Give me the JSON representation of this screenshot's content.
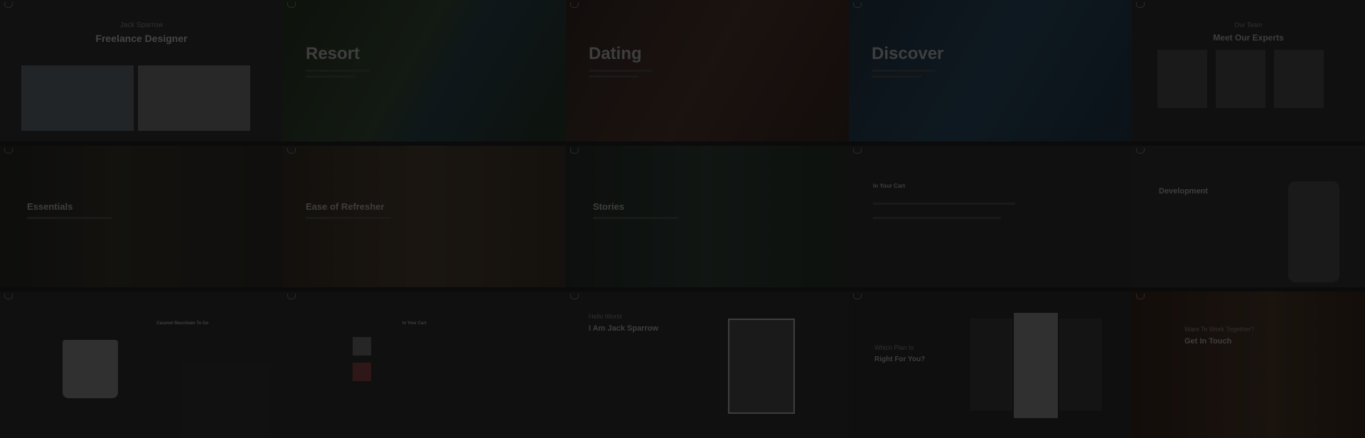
{
  "tiles": [
    {
      "id": "freelance",
      "kicker": "Jack Sparrow",
      "title": "Freelance Designer"
    },
    {
      "id": "resort",
      "title": "Resort"
    },
    {
      "id": "dating",
      "title": "Dating"
    },
    {
      "id": "discover",
      "title": "Discover"
    },
    {
      "id": "team",
      "kicker": "Our Team",
      "title": "Meet Our Experts"
    },
    {
      "id": "essentials",
      "title": "Essentials"
    },
    {
      "id": "ease",
      "title": "Ease of Refresher"
    },
    {
      "id": "stories",
      "title": "Stories"
    },
    {
      "id": "cart",
      "title": "In Your Cart"
    },
    {
      "id": "development",
      "title": "Development"
    },
    {
      "id": "mug",
      "title": "Caramel Macchiato To Go"
    },
    {
      "id": "cart2",
      "title": "In Your Cart"
    },
    {
      "id": "portfolio",
      "kicker": "Hello World",
      "title": "I Am Jack Sparrow"
    },
    {
      "id": "pricing",
      "kicker": "Which Plan Is",
      "title": "Right For You?"
    },
    {
      "id": "contact",
      "kicker": "Want To Work Together?",
      "title": "Get In Touch"
    }
  ]
}
